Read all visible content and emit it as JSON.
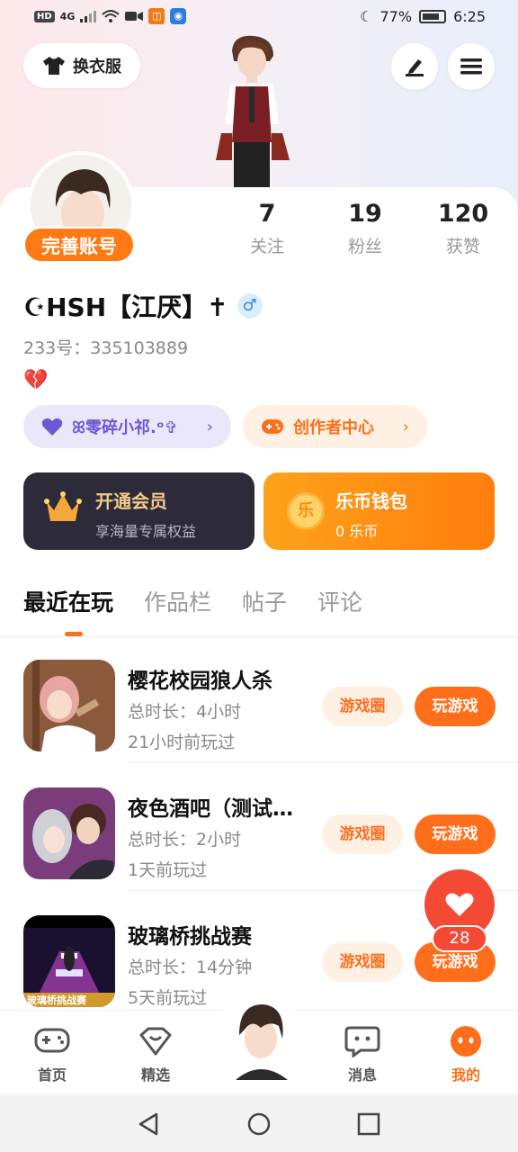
{
  "status_bar": {
    "hd": "HD",
    "signal": "4G",
    "battery_pct": "77%",
    "time": "6:25"
  },
  "header": {
    "outfit_label": "换衣服"
  },
  "profile": {
    "complete_label": "完善账号",
    "username": "☪HSH【江厌】✝",
    "gender_symbol": "♂",
    "uid": "233号：335103889"
  },
  "stats": [
    {
      "value": "7",
      "label": "关注"
    },
    {
      "value": "19",
      "label": "粉丝"
    },
    {
      "value": "120",
      "label": "获赞"
    }
  ],
  "pills": {
    "guild_label": "ꕤ零碎小祁.ᵒ✞",
    "creator_label": "创作者中心",
    "chevron": "›"
  },
  "vip": {
    "title": "开通会员",
    "subtitle": "享海量专属权益"
  },
  "wallet": {
    "title": "乐币钱包",
    "subtitle": "0 乐币",
    "coin_glyph": "乐"
  },
  "tabs": [
    {
      "label": "最近在玩",
      "active": true
    },
    {
      "label": "作品栏",
      "active": false
    },
    {
      "label": "帖子",
      "active": false
    },
    {
      "label": "评论",
      "active": false
    }
  ],
  "games": [
    {
      "name": "樱花校园狼人杀",
      "duration": "总时长：4小时",
      "last_played": "21小时前玩过",
      "circle_label": "游戏圈",
      "play_label": "玩游戏"
    },
    {
      "name": "夜色酒吧（测试…",
      "duration": "总时长：2小时",
      "last_played": "1天前玩过",
      "circle_label": "游戏圈",
      "play_label": "玩游戏"
    },
    {
      "name": "玻璃桥挑战赛",
      "duration": "总时长：14分钟",
      "last_played": "5天前玩过",
      "circle_label": "游戏圈",
      "play_label": "玩游戏"
    }
  ],
  "game3_icon_text": "玻璃桥挑战赛",
  "like_fab": {
    "count": "28"
  },
  "bottom_nav": [
    {
      "label": "首页",
      "active": false
    },
    {
      "label": "精选",
      "active": false
    },
    {
      "label": "消息",
      "active": false
    },
    {
      "label": "我的",
      "active": true
    }
  ],
  "colors": {
    "accent": "#ff6e1a",
    "vip_bg": "#2d2b3a",
    "like": "#f44a35",
    "guild": "#6b58d6"
  }
}
